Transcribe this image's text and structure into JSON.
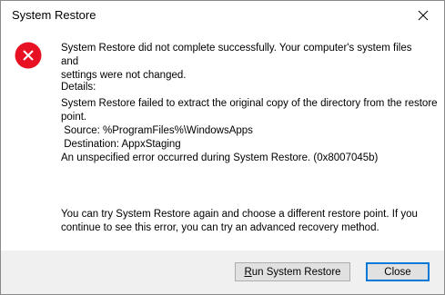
{
  "window": {
    "title": "System Restore"
  },
  "icons": {
    "error": "error-circle-icon",
    "close": "close-icon"
  },
  "colors": {
    "error_red": "#e81123",
    "focus_blue": "#0078d7"
  },
  "message": {
    "main_line1": "System Restore did not complete successfully. Your computer's system files and",
    "main_line2": "settings were not changed.",
    "details_label": "Details:",
    "details_lines": [
      "System Restore failed to extract the original copy of the directory from the restore",
      "point.",
      " Source: %ProgramFiles%\\WindowsApps",
      " Destination: AppxStaging",
      "An unspecified error occurred during System Restore. (0x8007045b)"
    ],
    "hint_line1": "You can try System Restore again and choose a different restore point. If you",
    "hint_line2": "continue to see this error, you can try an advanced recovery method."
  },
  "buttons": {
    "run_accel": "R",
    "run_rest": "un System Restore",
    "close": "Close"
  }
}
